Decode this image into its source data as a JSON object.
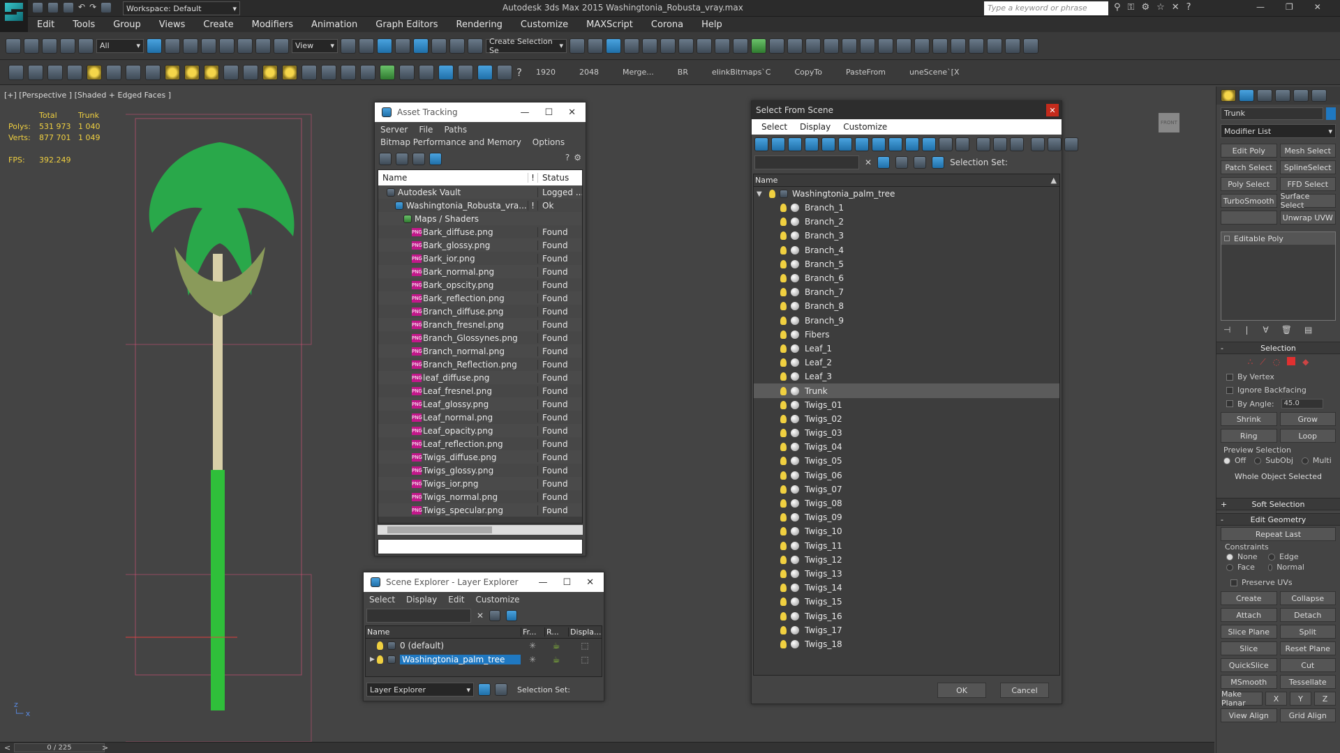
{
  "app": {
    "title": "Autodesk 3ds Max  2015    Washingtonia_Robusta_vray.max",
    "workspace": "Workspace: Default",
    "search_placeholder": "Type a keyword or phrase"
  },
  "menu": [
    "Edit",
    "Tools",
    "Group",
    "Views",
    "Create",
    "Modifiers",
    "Animation",
    "Graph Editors",
    "Rendering",
    "Customize",
    "MAXScript",
    "Corona",
    "Help"
  ],
  "toolbar1": {
    "filter": "All",
    "refcoord": "View",
    "selset": "Create Selection Se"
  },
  "toolbar2": {
    "items": [
      "1920",
      "2048",
      "Merge...",
      "BR",
      "elinkBitmaps`C",
      "CopyTo",
      "PasteFrom",
      "uneScene`[X"
    ]
  },
  "viewport": {
    "label": "[+] [Perspective ] [Shaded + Edged Faces ]",
    "stats": {
      "h_total": "Total",
      "h_obj": "Trunk",
      "polys_label": "Polys:",
      "polys_total": "531 973",
      "polys_obj": "1 040",
      "verts_label": "Verts:",
      "verts_total": "877 701",
      "verts_obj": "1 049",
      "fps_label": "FPS:",
      "fps": "392.249"
    },
    "viewcube": "FRONT"
  },
  "status": {
    "frame": "0 / 225"
  },
  "asset_tracking": {
    "title": "Asset Tracking",
    "menu": [
      "Server",
      "File",
      "Paths"
    ],
    "menu2": [
      "Bitmap Performance and Memory",
      "Options"
    ],
    "col_name": "Name",
    "col_flag": "!",
    "col_status": "Status",
    "rows": [
      {
        "name": "Autodesk Vault",
        "status": "Logged ...",
        "level": 1,
        "type": "vault"
      },
      {
        "name": "Washingtonia_Robusta_vra...",
        "status": "Ok",
        "level": 2,
        "type": "max",
        "flag": "!"
      },
      {
        "name": "Maps / Shaders",
        "status": "",
        "level": 3,
        "type": "maps"
      },
      {
        "name": "Bark_diffuse.png",
        "status": "Found",
        "level": 4,
        "type": "png"
      },
      {
        "name": "Bark_glossy.png",
        "status": "Found",
        "level": 4,
        "type": "png"
      },
      {
        "name": "Bark_ior.png",
        "status": "Found",
        "level": 4,
        "type": "png"
      },
      {
        "name": "Bark_normal.png",
        "status": "Found",
        "level": 4,
        "type": "png"
      },
      {
        "name": "Bark_opscity.png",
        "status": "Found",
        "level": 4,
        "type": "png"
      },
      {
        "name": "Bark_reflection.png",
        "status": "Found",
        "level": 4,
        "type": "png"
      },
      {
        "name": "Branch_diffuse.png",
        "status": "Found",
        "level": 4,
        "type": "png"
      },
      {
        "name": "Branch_fresnel.png",
        "status": "Found",
        "level": 4,
        "type": "png"
      },
      {
        "name": "Branch_Glossynes.png",
        "status": "Found",
        "level": 4,
        "type": "png"
      },
      {
        "name": "Branch_normal.png",
        "status": "Found",
        "level": 4,
        "type": "png"
      },
      {
        "name": "Branch_Reflection.png",
        "status": "Found",
        "level": 4,
        "type": "png"
      },
      {
        "name": "leaf_diffuse.png",
        "status": "Found",
        "level": 4,
        "type": "png"
      },
      {
        "name": "Leaf_fresnel.png",
        "status": "Found",
        "level": 4,
        "type": "png"
      },
      {
        "name": "Leaf_glossy.png",
        "status": "Found",
        "level": 4,
        "type": "png"
      },
      {
        "name": "Leaf_normal.png",
        "status": "Found",
        "level": 4,
        "type": "png"
      },
      {
        "name": "Leaf_opacity.png",
        "status": "Found",
        "level": 4,
        "type": "png"
      },
      {
        "name": "Leaf_reflection.png",
        "status": "Found",
        "level": 4,
        "type": "png"
      },
      {
        "name": "Twigs_diffuse.png",
        "status": "Found",
        "level": 4,
        "type": "png"
      },
      {
        "name": "Twigs_glossy.png",
        "status": "Found",
        "level": 4,
        "type": "png"
      },
      {
        "name": "Twigs_ior.png",
        "status": "Found",
        "level": 4,
        "type": "png"
      },
      {
        "name": "Twigs_normal.png",
        "status": "Found",
        "level": 4,
        "type": "png"
      },
      {
        "name": "Twigs_specular.png",
        "status": "Found",
        "level": 4,
        "type": "png"
      }
    ]
  },
  "layer_explorer": {
    "title": "Scene Explorer - Layer Explorer",
    "menu": [
      "Select",
      "Display",
      "Edit",
      "Customize"
    ],
    "cols": [
      "Name",
      "Fr...",
      "R...",
      "Displa..."
    ],
    "rows": [
      {
        "name": "0 (default)",
        "selected": false
      },
      {
        "name": "Washingtonia_palm_tree",
        "selected": true
      }
    ],
    "footer_combo": "Layer Explorer",
    "selset_label": "Selection Set:"
  },
  "select_from_scene": {
    "title": "Select From Scene",
    "menu": [
      "Select",
      "Display",
      "Customize"
    ],
    "selset_label": "Selection Set:",
    "col_name": "Name",
    "root": "Washingtonia_palm_tree",
    "items": [
      "Branch_1",
      "Branch_2",
      "Branch_3",
      "Branch_4",
      "Branch_5",
      "Branch_6",
      "Branch_7",
      "Branch_8",
      "Branch_9",
      "Fibers",
      "Leaf_1",
      "Leaf_2",
      "Leaf_3",
      "Trunk",
      "Twigs_01",
      "Twigs_02",
      "Twigs_03",
      "Twigs_04",
      "Twigs_05",
      "Twigs_06",
      "Twigs_07",
      "Twigs_08",
      "Twigs_09",
      "Twigs_10",
      "Twigs_11",
      "Twigs_12",
      "Twigs_13",
      "Twigs_14",
      "Twigs_15",
      "Twigs_16",
      "Twigs_17",
      "Twigs_18"
    ],
    "selected": "Trunk",
    "ok": "OK",
    "cancel": "Cancel"
  },
  "command_panel": {
    "object_name": "Trunk",
    "modifier_list": "Modifier List",
    "mod_buttons": [
      [
        "Edit Poly",
        "Mesh Select"
      ],
      [
        "Patch Select",
        "SplineSelect"
      ],
      [
        "Poly Select",
        "FFD Select"
      ],
      [
        "TurboSmooth",
        "Surface Select"
      ],
      [
        "",
        "Unwrap UVW"
      ]
    ],
    "stack_item": "Editable Poly",
    "selection_head": "Selection",
    "by_vertex": "By Vertex",
    "ignore_backfacing": "Ignore Backfacing",
    "by_angle": "By Angle:",
    "angle_value": "45.0",
    "shrink": "Shrink",
    "grow": "Grow",
    "ring": "Ring",
    "loop": "Loop",
    "preview_selection": "Preview Selection",
    "preview_opts": [
      "Off",
      "SubObj",
      "Multi"
    ],
    "whole_object": "Whole Object Selected",
    "soft_selection": "Soft Selection",
    "edit_geometry": "Edit Geometry",
    "repeat_last": "Repeat Last",
    "constraints": "Constraints",
    "constraint_opts": [
      "None",
      "Edge",
      "Face",
      "Normal"
    ],
    "preserve_uvs": "Preserve UVs",
    "create": "Create",
    "collapse": "Collapse",
    "attach": "Attach",
    "detach": "Detach",
    "slice_plane": "Slice Plane",
    "split": "Split",
    "slice": "Slice",
    "reset_plane": "Reset Plane",
    "quickslice": "QuickSlice",
    "cut": "Cut",
    "msmooth": "MSmooth",
    "tessellate": "Tessellate",
    "make_planar": "Make Planar",
    "x": "X",
    "y": "Y",
    "z": "Z",
    "view_align": "View Align",
    "grid_align": "Grid Align"
  },
  "colors": {
    "accent": "#1f78c1",
    "selected_row": "#5b5b5b",
    "found": "#e0e0e0",
    "tree_green": "#2fbf3a"
  }
}
